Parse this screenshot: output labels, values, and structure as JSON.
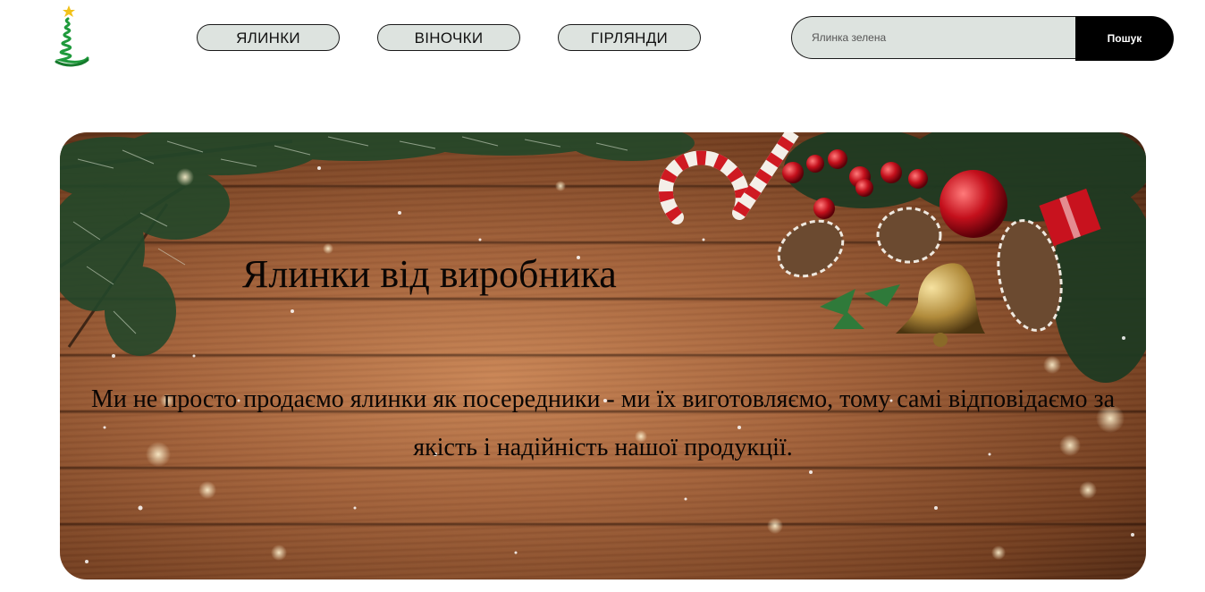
{
  "header": {
    "logo_icon": "christmas-tree-logo-icon",
    "nav": [
      {
        "label": "ЯЛИНКИ"
      },
      {
        "label": "ВІНОЧКИ"
      },
      {
        "label": "ГІРЛЯНДИ"
      }
    ],
    "search": {
      "placeholder": "Ялинка зелена",
      "button_label": "Пошук"
    }
  },
  "hero": {
    "title": "Ялинки від виробника",
    "text": "Ми не просто продаємо ялинки як посередники - ми їх виготовляємо, тому самі відповідаємо за якість і надійність нашої продукції.",
    "background": "wooden-christmas-decor-image"
  },
  "colors": {
    "nav_bg": "#dde3df",
    "search_button_bg": "#000000",
    "logo_green": "#1f9a3c",
    "logo_star": "#f2c21a"
  }
}
